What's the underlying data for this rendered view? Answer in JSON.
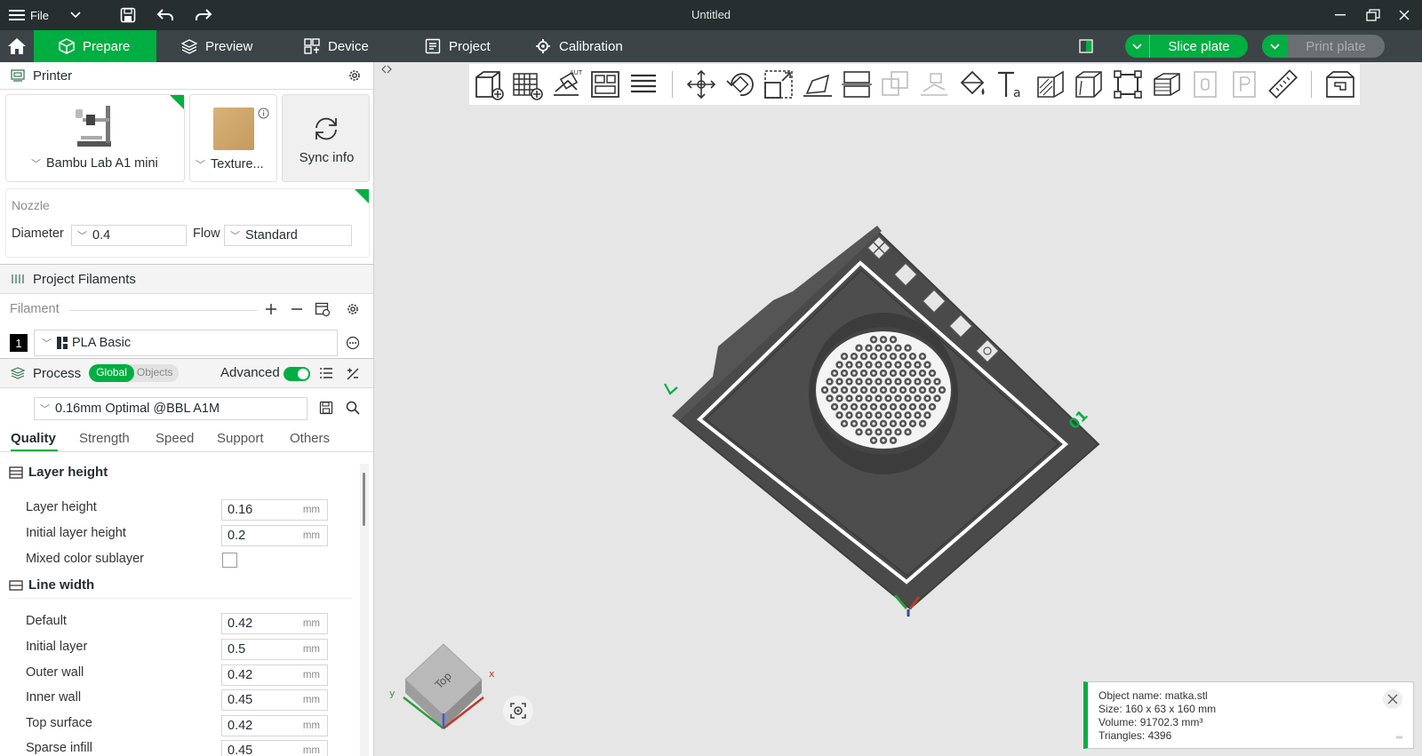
{
  "titlebar": {
    "file_label": "File",
    "title": "Untitled"
  },
  "navbar": {
    "tabs": [
      {
        "label": "Prepare",
        "icon": "cube-icon",
        "active": true
      },
      {
        "label": "Preview",
        "icon": "layers-icon",
        "active": false
      },
      {
        "label": "Device",
        "icon": "device-icon",
        "active": false
      },
      {
        "label": "Project",
        "icon": "project-icon",
        "active": false
      },
      {
        "label": "Calibration",
        "icon": "calibration-icon",
        "active": false
      }
    ],
    "slice_label": "Slice plate",
    "print_label": "Print plate"
  },
  "printer": {
    "section_title": "Printer",
    "printer_name": "Bambu Lab A1 mini",
    "plate_name": "Texture...",
    "sync_label": "Sync info",
    "nozzle_label": "Nozzle",
    "diameter_label": "Diameter",
    "diameter_value": "0.4",
    "flow_label": "Flow",
    "flow_value": "Standard"
  },
  "filaments": {
    "section_title": "Project Filaments",
    "filament_label": "Filament",
    "items": [
      {
        "index": "1",
        "name": "PLA Basic",
        "color": "#000000"
      }
    ]
  },
  "process": {
    "section_title": "Process",
    "toggle_global": "Global",
    "toggle_objects": "Objects",
    "advanced_label": "Advanced",
    "advanced_on": true,
    "preset": "0.16mm Optimal @BBL A1M",
    "tabs": [
      "Quality",
      "Strength",
      "Speed",
      "Support",
      "Others"
    ],
    "active_tab": "Quality",
    "layer_height_group": "Layer height",
    "layer_rows": [
      {
        "label": "Layer height",
        "value": "0.16",
        "unit": "mm"
      },
      {
        "label": "Initial layer height",
        "value": "0.2",
        "unit": "mm"
      }
    ],
    "mixed_label": "Mixed color sublayer",
    "mixed_checked": false,
    "line_width_group": "Line width",
    "line_rows": [
      {
        "label": "Default",
        "value": "0.42",
        "unit": "mm"
      },
      {
        "label": "Initial layer",
        "value": "0.5",
        "unit": "mm"
      },
      {
        "label": "Outer wall",
        "value": "0.42",
        "unit": "mm"
      },
      {
        "label": "Inner wall",
        "value": "0.45",
        "unit": "mm"
      },
      {
        "label": "Top surface",
        "value": "0.42",
        "unit": "mm"
      },
      {
        "label": "Sparse infill",
        "value": "0.45",
        "unit": "mm"
      }
    ]
  },
  "viewport": {
    "plate_number": "01",
    "cube_label": "Top",
    "axis_x": "x",
    "axis_y": "y",
    "toolbar_icons": [
      "add-object-icon",
      "add-plate-icon",
      "auto-orient-icon",
      "arrange-icon",
      "split-layers-icon",
      "move-icon",
      "rotate-icon",
      "scale-icon",
      "lay-on-face-icon",
      "cut-icon",
      "boolean-icon",
      "mesh-boolean-icon",
      "paint-icon",
      "text-icon",
      "seam-icon",
      "support-paint-icon",
      "assembly-icon",
      "measure-bbox-icon",
      "variable-layer-icon",
      "brim-ears-icon",
      "plate-icon",
      "ruler-icon",
      "assembly-view-icon"
    ]
  },
  "object_info": {
    "name": "Object name: matka.stl",
    "size": "Size: 160 x 63 x 160 mm",
    "volume": "Volume: 91702.3 mm³",
    "triangles": "Triangles: 4396"
  },
  "colors": {
    "accent": "#00ae42",
    "titlebar": "#262e30",
    "navbar": "#3c4447",
    "bed": "#4a4a4a"
  }
}
